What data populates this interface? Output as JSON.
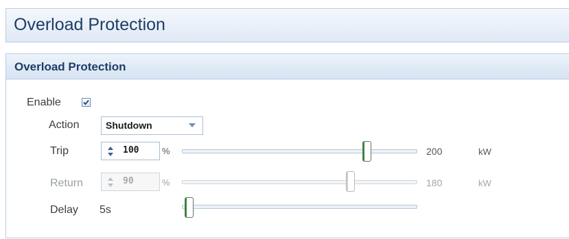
{
  "page": {
    "title": "Overload Protection"
  },
  "panel": {
    "title": "Overload Protection",
    "enable": {
      "label": "Enable",
      "checked": true
    },
    "action": {
      "label": "Action",
      "selected": "Shutdown"
    },
    "trip": {
      "label": "Trip",
      "value": "100",
      "unit_pct": "%",
      "max": "200",
      "unit": "kW",
      "slider_fraction": 0.79
    },
    "return": {
      "label": "Return",
      "value": "90",
      "unit_pct": "%",
      "max": "180",
      "unit": "kW",
      "slider_fraction": 0.72,
      "disabled": true
    },
    "delay": {
      "label": "Delay",
      "value": "5s",
      "slider_fraction": 0.03
    }
  },
  "icons": {
    "checkbox_check": "check-icon",
    "dropdown": "chevron-down-icon",
    "spinner": "spin-arrows-icon"
  },
  "colors": {
    "title": "#1e3d66",
    "thumb_accent": "#2e8a36"
  }
}
